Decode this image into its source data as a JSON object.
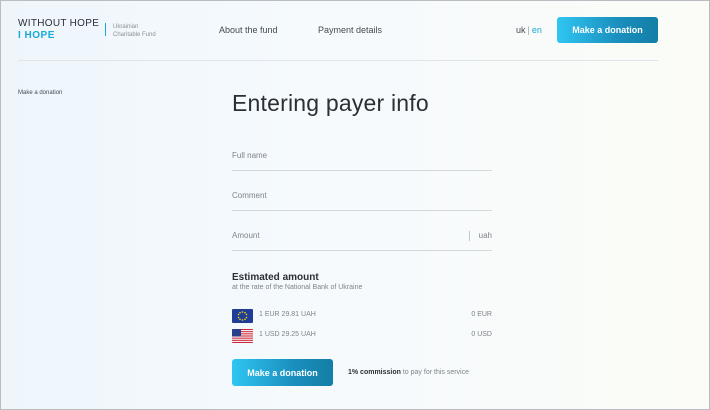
{
  "header": {
    "logo_line1": "WITHOUT HOPE",
    "logo_line2": "I HOPE",
    "logo_sub_line1": "Ukrainian",
    "logo_sub_line2": "Charitable Fund",
    "nav": [
      {
        "label": "About the fund"
      },
      {
        "label": "Payment details"
      }
    ],
    "lang_uk": "uk",
    "lang_sep": "|",
    "lang_en": "en",
    "donate_button": "Make a donation"
  },
  "breadcrumb": "Make a donation",
  "main": {
    "title": "Entering payer info",
    "fields": {
      "full_name_placeholder": "Full name",
      "comment_placeholder": "Comment",
      "amount_placeholder": "Amount",
      "amount_unit": "uah"
    },
    "estimate": {
      "title": "Estimated amount",
      "subtitle": "at the rate of the National Bank of Ukraine",
      "rows": [
        {
          "rate": "1 EUR 29.81 UAH",
          "value": "0 EUR",
          "flag": "eu-flag-icon"
        },
        {
          "rate": "1 USD 29.25 UAH",
          "value": "0 USD",
          "flag": "us-flag-icon"
        }
      ]
    },
    "donate_button": "Make a donation",
    "commission_bold": "1% commission",
    "commission_rest": " to pay for this service"
  },
  "colors": {
    "accent": "#1aa8d8",
    "button_start": "#2fc6f2",
    "button_end": "#137ea6"
  }
}
